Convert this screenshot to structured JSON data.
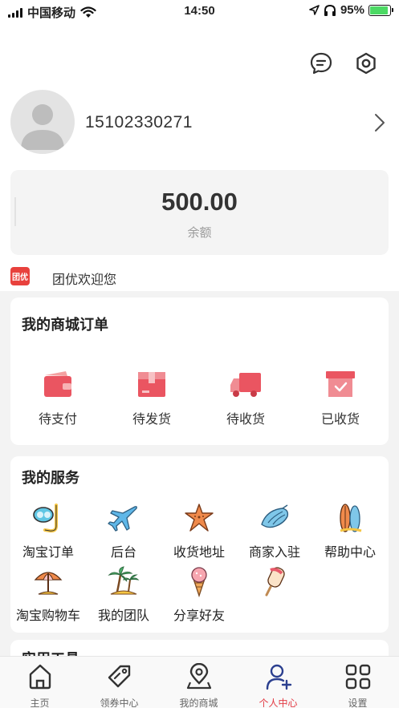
{
  "status_bar": {
    "carrier": "中国移动",
    "time": "14:50",
    "battery": "95%"
  },
  "header": {
    "message_icon": "chat-bubble-icon",
    "settings_icon": "hexagon-settings-icon"
  },
  "profile": {
    "phone": "15102330271",
    "avatar_icon": "default-avatar-icon"
  },
  "balance": {
    "value": "500.00",
    "label": "余额"
  },
  "welcome": {
    "logo_text": "团优",
    "text": "团优欢迎您"
  },
  "orders": {
    "title": "我的商城订单",
    "items": [
      {
        "label": "待支付",
        "icon": "wallet-icon"
      },
      {
        "label": "待发货",
        "icon": "package-icon"
      },
      {
        "label": "待收货",
        "icon": "truck-icon"
      },
      {
        "label": "已收货",
        "icon": "received-box-icon"
      }
    ]
  },
  "services": {
    "title": "我的服务",
    "items": [
      {
        "label": "淘宝订单",
        "icon": "snorkel-icon"
      },
      {
        "label": "后台",
        "icon": "airplane-icon"
      },
      {
        "label": "收货地址",
        "icon": "starfish-icon"
      },
      {
        "label": "商家入驻",
        "icon": "seashell-icon"
      },
      {
        "label": "帮助中心",
        "icon": "surfboard-icon"
      },
      {
        "label": "淘宝购物车",
        "icon": "beach-umbrella-icon"
      },
      {
        "label": "我的团队",
        "icon": "palm-island-icon"
      },
      {
        "label": "分享好友",
        "icon": "ice-cream-cone-icon"
      },
      {
        "label": "",
        "icon": "popsicle-icon"
      }
    ]
  },
  "tools": {
    "title": "实用工具"
  },
  "tab_bar": {
    "items": [
      {
        "label": "主页",
        "icon": "home-icon"
      },
      {
        "label": "领券中心",
        "icon": "coupon-tag-icon"
      },
      {
        "label": "我的商城",
        "icon": "map-pin-icon"
      },
      {
        "label": "个人中心",
        "icon": "user-add-icon",
        "active": true
      },
      {
        "label": "设置",
        "icon": "grid-icon"
      }
    ]
  },
  "colors": {
    "accent": "#e33a44",
    "icon_red": "#ea5561"
  }
}
